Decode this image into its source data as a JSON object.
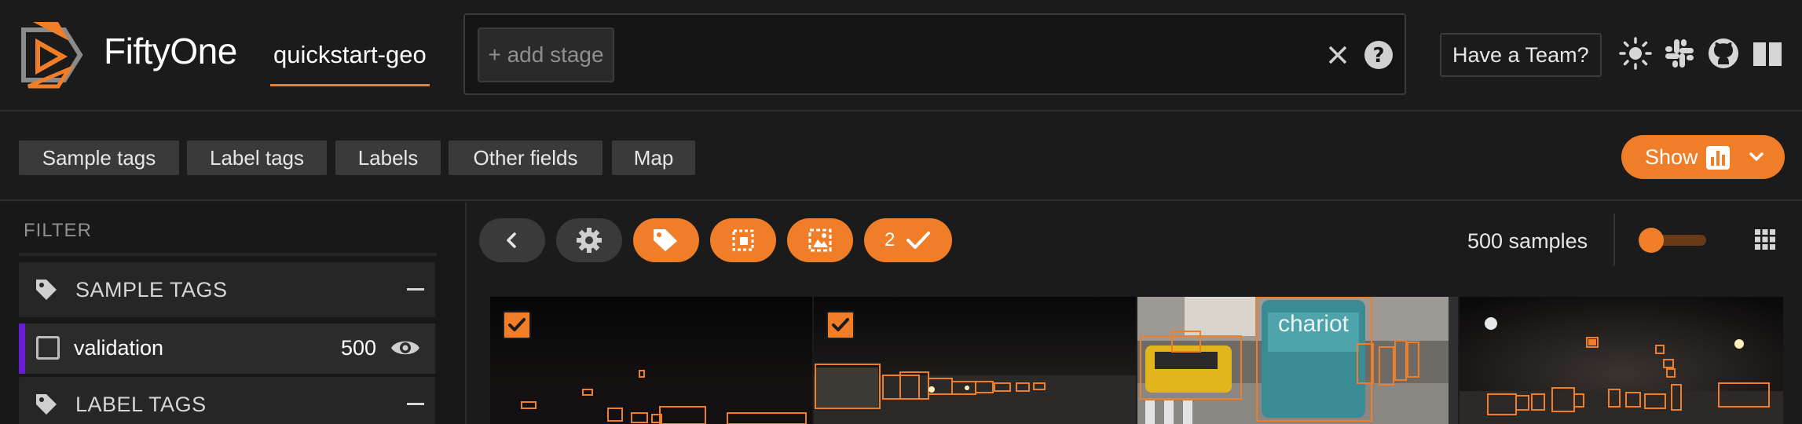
{
  "header": {
    "brand": "FiftyOne",
    "dataset_name": "quickstart-geo",
    "add_stage_label": "+ add stage",
    "team_button": "Have a Team?"
  },
  "tabs": [
    {
      "label": "Sample tags"
    },
    {
      "label": "Label tags"
    },
    {
      "label": "Labels"
    },
    {
      "label": "Other fields"
    },
    {
      "label": "Map"
    }
  ],
  "show_button": {
    "label": "Show"
  },
  "sidebar": {
    "filter_title": "FILTER",
    "sample_tags_title": "SAMPLE TAGS",
    "label_tags_title": "LABEL TAGS",
    "tag_row": {
      "label": "validation",
      "count": "500",
      "checked": false
    }
  },
  "toolbar": {
    "selected_count": "2",
    "samples_text": "500 samples",
    "zoom_fraction": 0.25
  },
  "thumbnails": [
    {
      "selected": true
    },
    {
      "selected": true
    },
    {
      "selected": false,
      "sign_text": "chariot"
    },
    {
      "selected": false
    }
  ],
  "colors": {
    "accent": "#f07d28",
    "tag_accent": "#6a1bd6",
    "background": "#1b1b1b"
  },
  "icons": [
    "logo-icon",
    "close-icon",
    "help-icon",
    "sun-icon",
    "slack-icon",
    "github-icon",
    "book-icon",
    "bar-chart-icon",
    "chevron-down-icon",
    "tag-icon",
    "eye-icon",
    "chevron-left-icon",
    "gear-icon",
    "crop-icon",
    "image-icon",
    "check-icon",
    "grid-icon"
  ]
}
